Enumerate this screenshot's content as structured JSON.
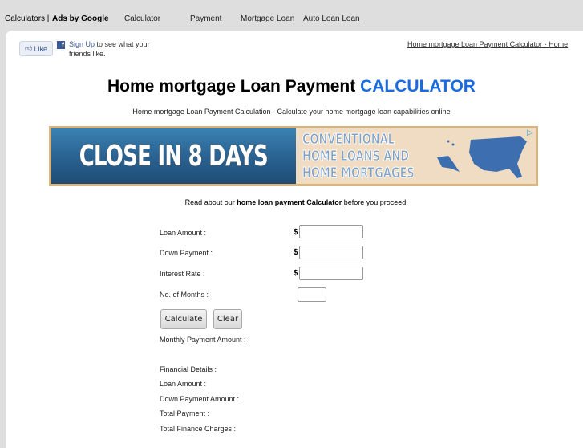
{
  "topnav": {
    "label": "Calculators |",
    "ads_label": "Ads by Google",
    "links": [
      "Calculator",
      "Payment",
      "Mortgage Loan",
      "Auto Loan Loan"
    ]
  },
  "facebook": {
    "like_label": "Like",
    "signup_label": "Sign Up",
    "signup_text": " to see what your friends like."
  },
  "home_link": "Home mortgage Loan Payment Calculator - Home",
  "header": {
    "title_main": "Home mortgage Loan Payment",
    "title_accent": "CALCULATOR",
    "subtitle": "Home mortgage Loan Payment Calculation - Calculate your home mortgage loan capabilities online",
    "accent_color": "#1a6be0"
  },
  "banner": {
    "left_text": "CLOSE IN 8 DAYS",
    "right_lines": [
      "CONVENTIONAL",
      "HOME LOANS AND",
      "HOME MORTGAGES"
    ]
  },
  "read_about": {
    "prefix": "Read about our ",
    "link": "home loan payment Calculator ",
    "suffix": "before you proceed"
  },
  "form": {
    "fields": [
      {
        "label": "Loan Amount :",
        "currency": "$",
        "value": ""
      },
      {
        "label": "Down Payment :",
        "currency": "$",
        "value": ""
      },
      {
        "label": "Interest Rate :",
        "currency": "$",
        "value": ""
      },
      {
        "label": "No. of Months :",
        "value": ""
      }
    ],
    "calculate_label": "Calculate",
    "clear_label": "Clear",
    "monthly_label": "Monthly Payment Amount :"
  },
  "details": {
    "heading": "Financial Details :",
    "rows": [
      "Loan Amount :",
      "Down Payment Amount :",
      "Total Payment :",
      "Total Finance Charges :"
    ]
  }
}
